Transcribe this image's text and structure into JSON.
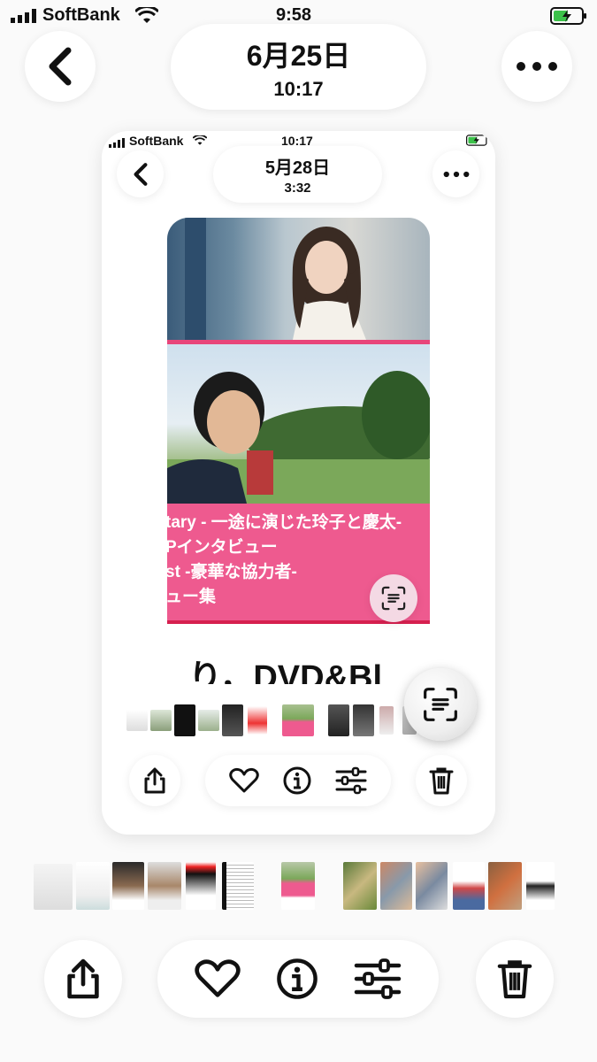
{
  "status_bar": {
    "carrier": "SoftBank",
    "time": "9:58",
    "battery": "charging"
  },
  "header": {
    "date": "6月25日",
    "time": "10:17"
  },
  "inner_screenshot": {
    "status_bar": {
      "carrier": "SoftBank",
      "time": "10:17"
    },
    "header": {
      "date": "5月28日",
      "time": "3:32"
    },
    "photo": {
      "caption_lines": [
        "tary - 一途に演じた玲子と慶太-",
        "Pインタビュー",
        "st -豪華な協力者-",
        "ュー集"
      ],
      "bottom_text": "り，DVD&Bl"
    }
  },
  "toolbar": {
    "share_icon": "share-icon",
    "favorite_icon": "heart-icon",
    "info_icon": "info-icon",
    "adjust_icon": "sliders-icon",
    "delete_icon": "trash-icon"
  },
  "colors": {
    "accent_pink": "#e8457a",
    "caption_bg": "#ee5a8f",
    "background": "#fafafa"
  }
}
